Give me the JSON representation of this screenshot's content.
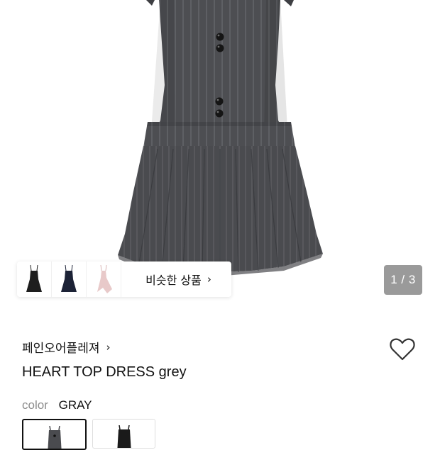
{
  "gallery": {
    "current_page": "1 / 3",
    "similar_products": {
      "label": "비슷한 상품",
      "chevron": "›",
      "thumbnails": [
        {
          "name": "black-slip-dress",
          "color": "#1e1e1e"
        },
        {
          "name": "navy-slip-dress",
          "color": "#1c2236"
        },
        {
          "name": "pink-asymmetric-dress",
          "color": "#e8c9c9"
        }
      ]
    }
  },
  "product": {
    "brand": "페인오어플레져",
    "brand_chevron": "›",
    "title": "HEART TOP DRESS grey",
    "wishlist_icon": "heart-outline-icon",
    "option": {
      "label": "color",
      "value": "GRAY",
      "swatches": [
        {
          "name": "gray",
          "color": "#4a4b4f",
          "selected": true
        },
        {
          "name": "black",
          "color": "#1a1a1a",
          "selected": false
        }
      ]
    }
  },
  "colors": {
    "dress": "#4d4e52",
    "stripe": "#8a8b90",
    "counter_bg": "#9a9a9a"
  }
}
